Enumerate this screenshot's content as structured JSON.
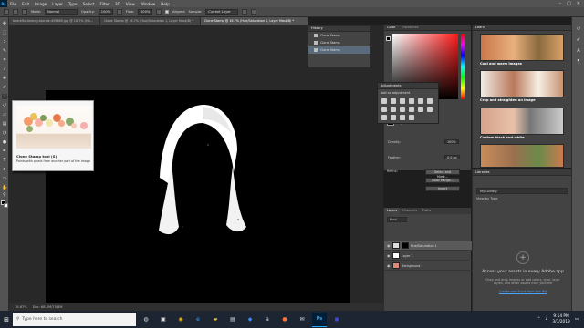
{
  "menubar": {
    "logo": "Ps",
    "items": [
      "File",
      "Edit",
      "Image",
      "Layer",
      "Type",
      "Select",
      "Filter",
      "3D",
      "View",
      "Window",
      "Help"
    ]
  },
  "options": {
    "mode_label": "Mode:",
    "mode_value": "Normal",
    "opacity_label": "Opacity:",
    "opacity_value": "100%",
    "flow_label": "Flow:",
    "flow_value": "100%",
    "aligned_label": "Aligned",
    "sample_label": "Sample:",
    "sample_value": "Current Layer"
  },
  "tabs": [
    "beautiful-beauty-blonde-459669.jpg @ 16.7% (Hu...",
    "Clone Stamp @ 16.7% (Hue/Saturation 1, Layer Mask/8) *",
    "Clone Stamp @ 16.7% (Hue/Saturation 1, Layer Mask/8) *"
  ],
  "history": {
    "title": "History",
    "rows": [
      "Clone Stamp",
      "Clone Stamp",
      "Clone Stamp"
    ]
  },
  "tooltip": {
    "title": "Clone Stamp tool (S)",
    "desc": "Paints with pixels from another part of the image"
  },
  "status": {
    "zoom": "16.67%",
    "doc": "Doc: 68.2M/75.8M"
  },
  "color_panel": {
    "tabs": [
      "Color",
      "Swatches"
    ]
  },
  "adjustments": {
    "title": "Adjustments",
    "subtitle": "Add an adjustment"
  },
  "properties": {
    "mask_label": "Layer Mask",
    "density_label": "Density:",
    "density_value": "100%",
    "feather_label": "Feather:",
    "feather_value": "0.0 px",
    "refine_label": "Refine:",
    "btn_select_mask": "Select and Mask...",
    "btn_color_range": "Color Range...",
    "btn_invert": "Invert"
  },
  "layers": {
    "tabs": [
      "Layers",
      "Channels",
      "Paths"
    ],
    "kind_label": "Kind",
    "rows": [
      {
        "name": "Hue/Saturation 1"
      },
      {
        "name": "Layer 1"
      },
      {
        "name": "Background"
      }
    ]
  },
  "learn": {
    "title": "Learn",
    "cards": [
      "Cool and warm images",
      "Crop and straighten an image",
      "Custom black and white"
    ]
  },
  "libraries": {
    "title": "Libraries",
    "library_name": "My Library",
    "view_by": "View by Type",
    "empty_heading": "Access your assets in every Adobe app",
    "empty_body": "Drag and drop images or add colors, type, layer styles, and other assets from your file",
    "create_link": "Create new Stock from this file"
  },
  "taskbar": {
    "search_placeholder": "Type here to search",
    "time": "9:14 PM",
    "date": "3/7/2019",
    "ps": "Ps"
  }
}
